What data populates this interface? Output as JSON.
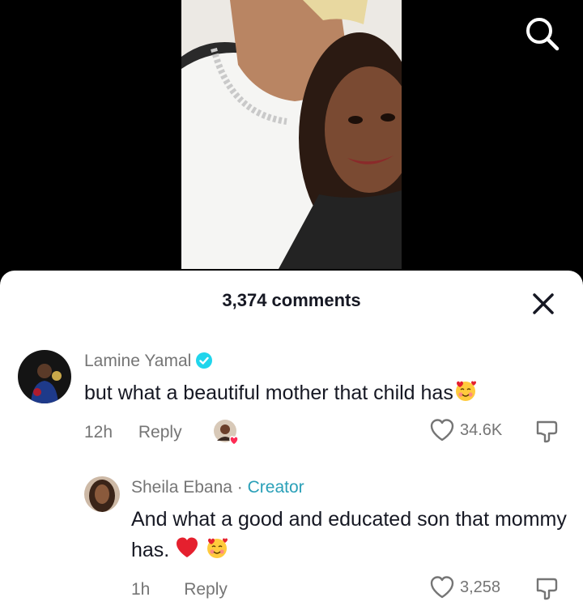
{
  "comments_sheet": {
    "count_label": "3,374 comments"
  },
  "comments": [
    {
      "username": "Lamine Yamal",
      "verified": true,
      "text": "but what a beautiful mother that child has",
      "time": "12h",
      "reply_label": "Reply",
      "likes": "34.6K",
      "creator_liked": true
    },
    {
      "username": "Sheila Ebana",
      "creator_separator": "·",
      "creator_label": "Creator",
      "text": "And what a good and educated son that mommy has.",
      "time": "1h",
      "reply_label": "Reply",
      "likes": "3,258"
    }
  ],
  "icons": {
    "search": "search-icon",
    "close": "close-icon",
    "verified": "verified-badge-icon",
    "heart": "heart-outline-icon",
    "dislike": "dislike-icon",
    "red_heart_emoji": "red-heart-emoji",
    "smiling_hearts_emoji": "smiling-face-with-hearts-emoji"
  },
  "colors": {
    "accent_verified": "#20d5ec",
    "creator_tag": "#2aa0b8",
    "muted_text": "#757575",
    "like_heart": "#fe2c55"
  }
}
